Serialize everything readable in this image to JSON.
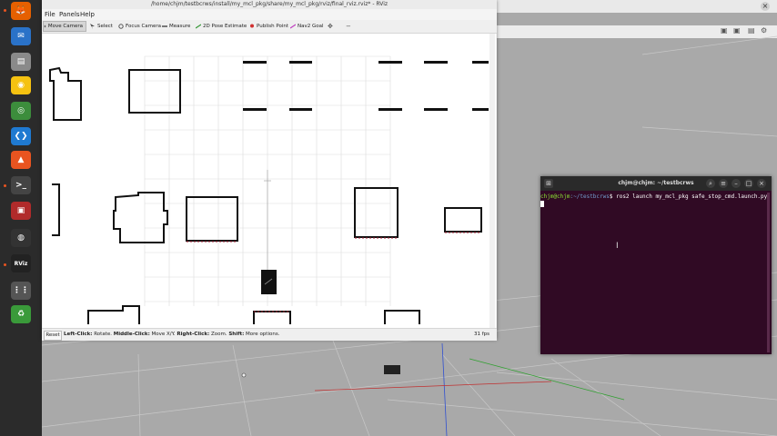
{
  "dock": {
    "apps": [
      {
        "name": "firefox-icon",
        "color": "#e66000",
        "glyph": "🦊"
      },
      {
        "name": "thunderbird-icon",
        "color": "#2a72c8",
        "glyph": "✉"
      },
      {
        "name": "files-icon",
        "color": "#8a8a8a",
        "glyph": "▤"
      },
      {
        "name": "rhythmbox-icon",
        "color": "#f5c211",
        "glyph": "◉"
      },
      {
        "name": "chrome-icon",
        "color": "#3c8d3c",
        "glyph": "◎"
      },
      {
        "name": "vscode-icon",
        "color": "#1f7ad1",
        "glyph": "❮❯"
      },
      {
        "name": "ubuntu-software-icon",
        "color": "#e95420",
        "glyph": "▲"
      },
      {
        "name": "terminal-icon",
        "color": "#444",
        "glyph": ">_"
      },
      {
        "name": "app-red-icon",
        "color": "#b12b2b",
        "glyph": "▣"
      },
      {
        "name": "obs-icon",
        "color": "#333",
        "glyph": "◍"
      },
      {
        "name": "rviz-icon",
        "color": "#222",
        "glyph": "RViz"
      },
      {
        "name": "show-apps-icon",
        "color": "#555",
        "glyph": "⋮⋮"
      },
      {
        "name": "trash-icon",
        "color": "#3a9a3a",
        "glyph": "♻"
      }
    ]
  },
  "rviz": {
    "title": "/home/chjm/testbcrws/install/my_mcl_pkg/share/my_mcl_pkg/rviz/final_rviz.rviz* - RViz",
    "menu": [
      "File",
      "Panels",
      "Help"
    ],
    "tools": [
      {
        "label": "Move Camera",
        "icon": "move-camera-icon"
      },
      {
        "label": "Select",
        "icon": "select-icon"
      },
      {
        "label": "Focus Camera",
        "icon": "focus-camera-icon"
      },
      {
        "label": "Measure",
        "icon": "measure-icon"
      },
      {
        "label": "2D Pose Estimate",
        "icon": "pose-estimate-icon"
      },
      {
        "label": "Publish Point",
        "icon": "publish-point-icon"
      },
      {
        "label": "Nav2 Goal",
        "icon": "nav2-goal-icon"
      }
    ],
    "reset_label": "Reset",
    "status": {
      "left_click": "Left-Click:",
      "left_click_desc": " Rotate. ",
      "middle_click": "Middle-Click:",
      "middle_click_desc": " Move X/Y. ",
      "right_click": "Right-Click:",
      "right_click_desc": " Zoom. ",
      "shift": "Shift:",
      "shift_desc": " More options."
    },
    "fps": "31 fps"
  },
  "terminal": {
    "title": "chjm@chjm: ~/testbcrws",
    "prompt_user": "chjm@chjm",
    "prompt_path": ":~/testbcrws",
    "command": "$ ros2 launch my_mcl_pkg safe_stop_cmd.launch.py"
  },
  "colors": {
    "terminal_bg": "#300a24",
    "dock_bg": "#2b2b2b",
    "accent": "#e95420"
  }
}
